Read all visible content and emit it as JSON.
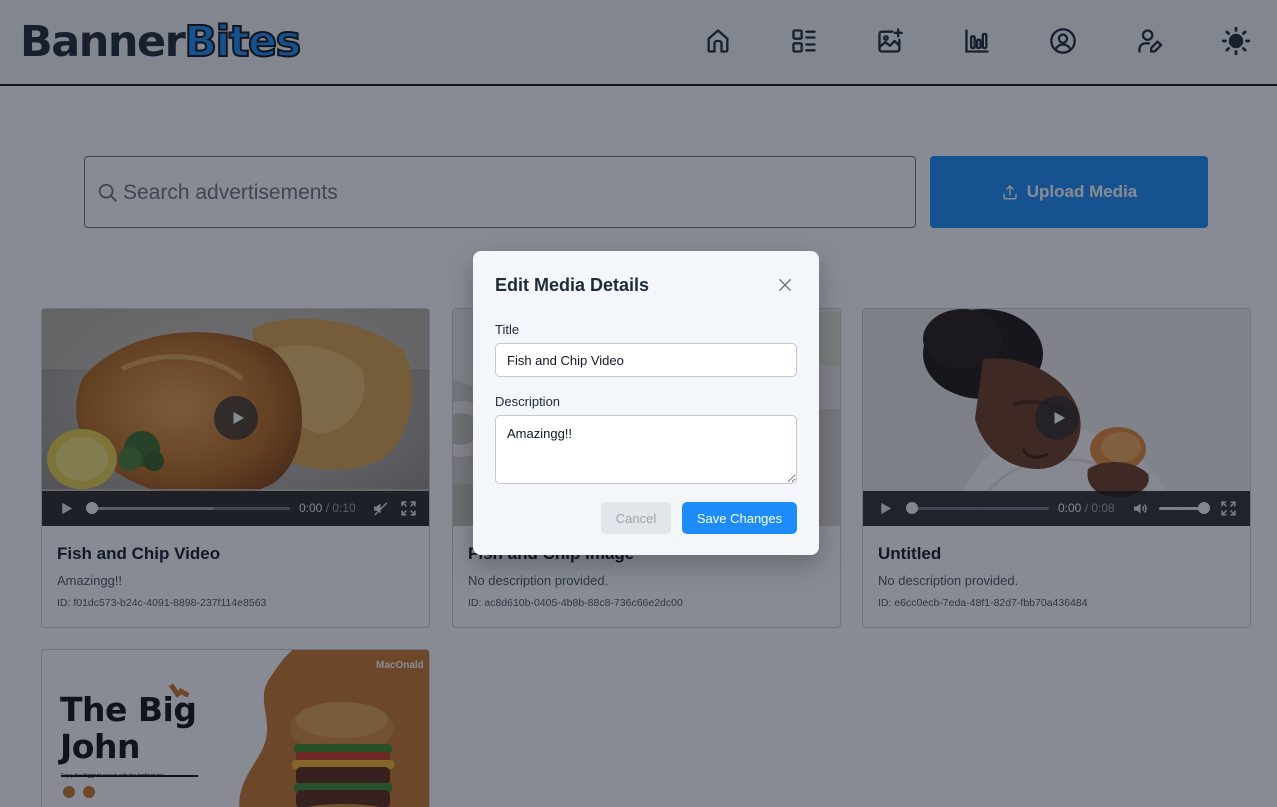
{
  "header": {
    "logo_part1": "Banner",
    "logo_part2": "Bites",
    "nav_icons": [
      "home-icon",
      "list-icon",
      "image-add-icon",
      "chart-icon",
      "account-icon",
      "user-edit-icon",
      "sun-icon"
    ]
  },
  "search": {
    "placeholder": "Search advertisements"
  },
  "upload": {
    "label": "Upload Media"
  },
  "cards": [
    {
      "title": "Fish and Chip Video",
      "description": "Amazingg!!",
      "id": "ID: f01dc573-b24c-4091-8898-237f114e8563",
      "type": "video",
      "current_time": "0:00",
      "duration": "/ 0:10",
      "muted": true
    },
    {
      "title": "Fish and Chip Image",
      "description": "No description provided.",
      "id": "ID: ac8d610b-0405-4b8b-88c8-736c66e2dc00",
      "type": "image"
    },
    {
      "title": "Untitled",
      "description": "No description provided.",
      "id": "ID: e6cc0ecb-7eda-48f1-82d7-fbb70a436484",
      "type": "video",
      "current_time": "0:00",
      "duration": "/ 0:08",
      "volume": 1.0
    },
    {
      "type": "image",
      "ad_brand": "MacOnald",
      "ad_headline_1": "The Big",
      "ad_headline_2": "John",
      "ad_tagline_pre": "Enjoy the ",
      "ad_tagline_b1": "biggest",
      "ad_tagline_mid": " crunch with the ",
      "ad_tagline_b2": "tastiest",
      "ad_tagline_post": " bite"
    }
  ],
  "modal": {
    "title": "Edit Media Details",
    "title_label": "Title",
    "title_value": "Fish and Chip Video",
    "description_label": "Description",
    "description_value": "Amazingg!!",
    "cancel_label": "Cancel",
    "save_label": "Save Changes"
  },
  "colors": {
    "accent": "#1d8cf8",
    "ad_orange": "#c8772a"
  }
}
